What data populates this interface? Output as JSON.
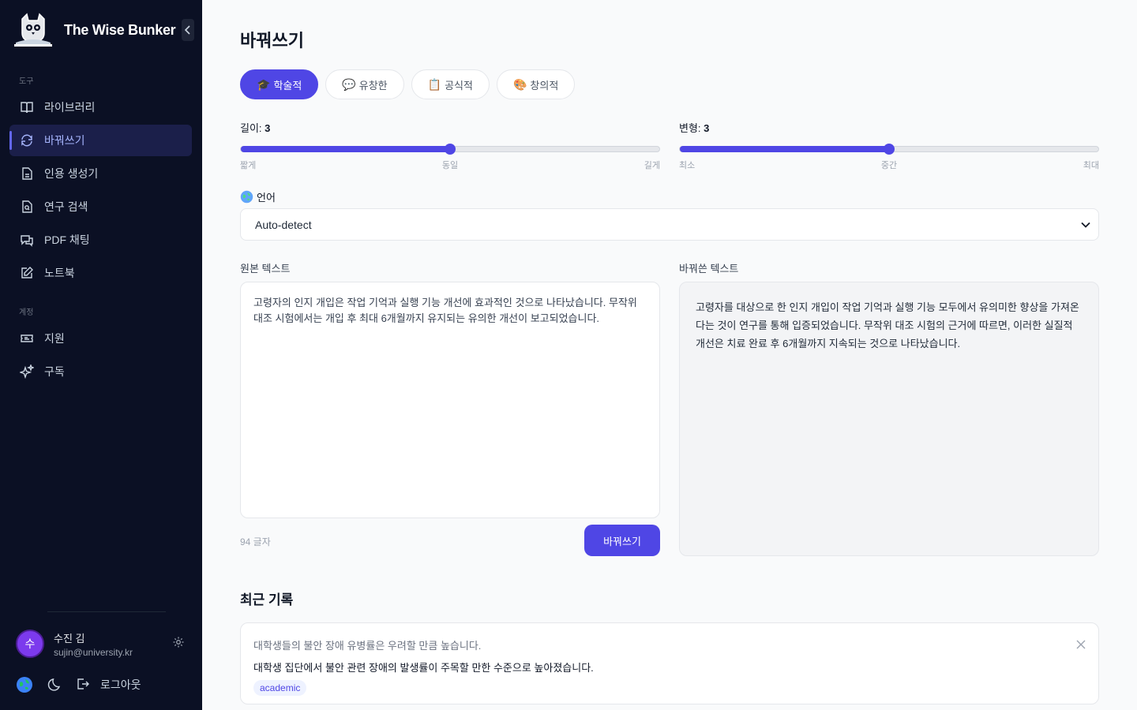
{
  "app": {
    "name": "The Wise Bunker"
  },
  "sidebar": {
    "section_tools": "도구",
    "section_account": "계정",
    "tools": [
      {
        "label": "라이브러리",
        "icon": "book-icon"
      },
      {
        "label": "바꿔쓰기",
        "icon": "refresh-icon",
        "active": true
      },
      {
        "label": "인용 생성기",
        "icon": "document-icon"
      },
      {
        "label": "연구 검색",
        "icon": "file-search-icon"
      },
      {
        "label": "PDF 채팅",
        "icon": "chat-icon"
      },
      {
        "label": "노트북",
        "icon": "edit-icon"
      }
    ],
    "account": [
      {
        "label": "지원",
        "icon": "ticket-icon"
      },
      {
        "label": "구독",
        "icon": "sparkles-icon"
      }
    ],
    "user": {
      "initial": "수",
      "name": "수진 김",
      "email": "sujin@university.kr"
    },
    "logout_label": "로그아웃"
  },
  "main": {
    "title": "바꿔쓰기",
    "tabs": [
      {
        "emoji": "🎓",
        "label": "학술적",
        "active": true
      },
      {
        "emoji": "💬",
        "label": "유창한"
      },
      {
        "emoji": "📋",
        "label": "공식적"
      },
      {
        "emoji": "🎨",
        "label": "창의적"
      }
    ],
    "length": {
      "label": "길이:",
      "value": "3",
      "fraction": 0.5,
      "ticks": [
        "짧게",
        "동일",
        "길게"
      ]
    },
    "variation": {
      "label": "변형:",
      "value": "3",
      "fraction": 0.5,
      "ticks": [
        "최소",
        "중간",
        "최대"
      ]
    },
    "language": {
      "label": "언어",
      "selected": "Auto-detect"
    },
    "source_label": "원본 텍스트",
    "source_text": "고령자의 인지 개입은 작업 기억과 실행 기능 개선에 효과적인 것으로 나타났습니다. 무작위 대조 시험에서는 개입 후 최대 6개월까지 유지되는 유의한 개선이 보고되었습니다.",
    "char_count": "94 글자",
    "run_button": "바꿔쓰기",
    "output_label": "바꿔쓴 텍스트",
    "output_text": "고령자를 대상으로 한 인지 개입이 작업 기억과 실행 기능 모두에서 유의미한 향상을 가져온다는 것이 연구를 통해 입증되었습니다. 무작위 대조 시험의 근거에 따르면, 이러한 실질적 개선은 치료 완료 후 6개월까지 지속되는 것으로 나타났습니다.",
    "recent_title": "최근 기록",
    "history": [
      {
        "original": "대학생들의 불안 장애 유병률은 우려할 만큼 높습니다.",
        "result": "대학생 집단에서 불안 관련 장애의 발생률이 주목할 만한 수준으로 높아졌습니다.",
        "tag": "academic"
      }
    ]
  },
  "colors": {
    "accent": "#4f46e5",
    "sidebar_bg": "#0b1024"
  }
}
